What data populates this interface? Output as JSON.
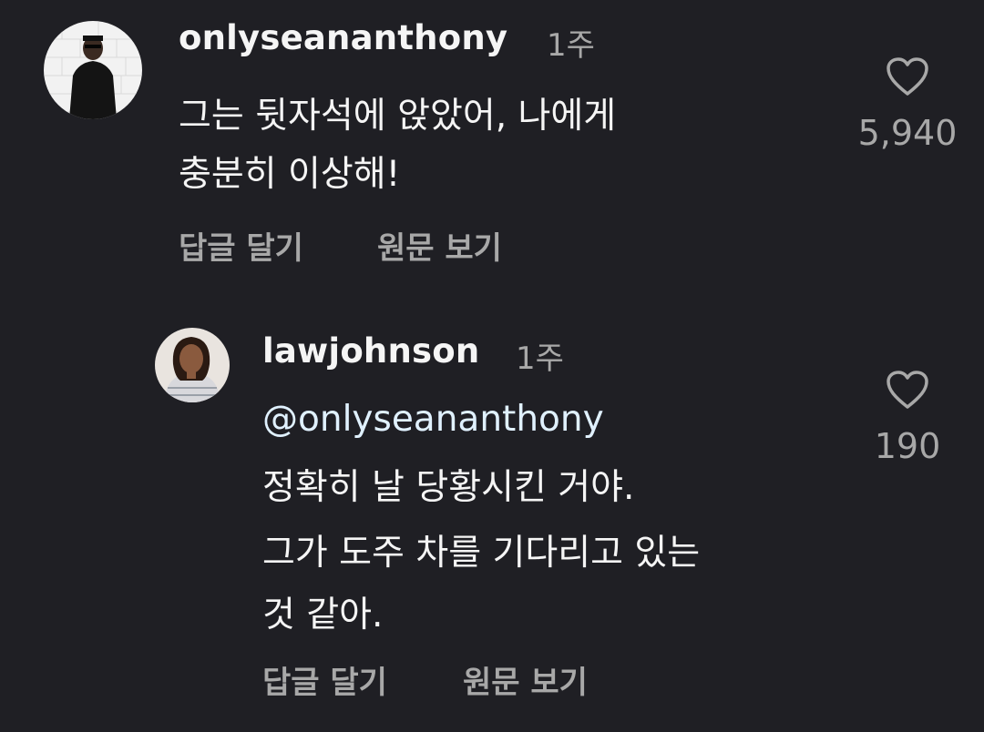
{
  "comments": [
    {
      "username": "onlyseananthony",
      "time": "1주",
      "lines": [
        "그는 뒷자석에 앉았어, 나에게",
        "충분히 이상해!"
      ],
      "reply_label": "답글 달기",
      "translate_label": "원문 보기",
      "like_icon": "heart-outline-icon",
      "like_count": "5,940"
    },
    {
      "username": "lawjohnson",
      "time": "1주",
      "mention": "@onlyseananthony",
      "lines": [
        "정확히 날 당황시킨 거야.",
        "그가 도주 차를 기다리고 있는",
        "것 같아."
      ],
      "reply_label": "답글 달기",
      "translate_label": "원문 보기",
      "like_icon": "heart-outline-icon",
      "like_count": "190"
    }
  ],
  "colors": {
    "background": "#1f1f24",
    "primary_text": "#f5f5f5",
    "secondary_text": "#a8a8a8",
    "mention": "#e0f1ff"
  }
}
